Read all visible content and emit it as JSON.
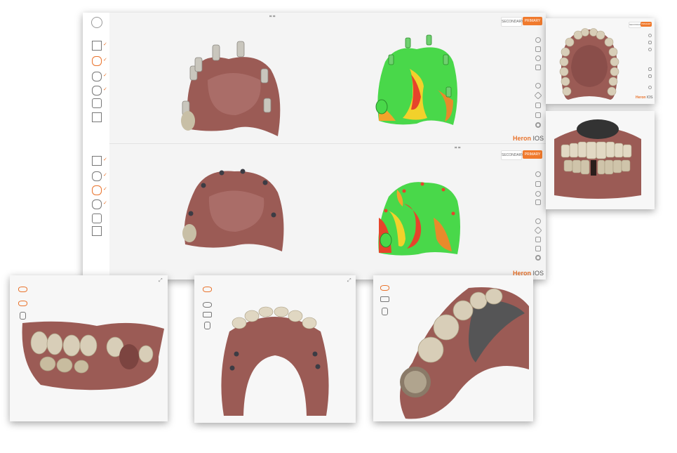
{
  "main_window": {
    "top_row": {
      "title_glyph": "⌗ ⌗",
      "btn_secondary": "SECONDARY",
      "btn_primary": "PRIMARY",
      "brand_main": "Heron",
      "brand_suffix": " IOS"
    },
    "bottom_row": {
      "title_glyph": "⌗ ⌗",
      "btn_secondary": "SECONDARY",
      "btn_primary": "PRIMARY",
      "brand_main": "Heron",
      "brand_suffix": " IOS"
    },
    "check_mark": "✓"
  },
  "side_window_top": {
    "btn_secondary": "SECONDARY",
    "btn_primary": "PRIMARY",
    "brand_main": "Heron",
    "brand_suffix": " IOS"
  },
  "expand_glyph": "⤢",
  "colors": {
    "accent": "#f07a2d",
    "gum": "#9b5b55",
    "teeth": "#d8ceb8",
    "deviation_green": "#49d84a",
    "deviation_red": "#e6442b",
    "deviation_yellow": "#f2d12b"
  },
  "icons": [
    "home-icon",
    "scan-upper-icon",
    "scan-lower-icon",
    "bite-icon",
    "analysis-icon",
    "search-icon",
    "trash-icon",
    "zoom-icon",
    "layers-icon",
    "measure-icon",
    "brush-icon",
    "eraser-icon",
    "settings-icon"
  ]
}
